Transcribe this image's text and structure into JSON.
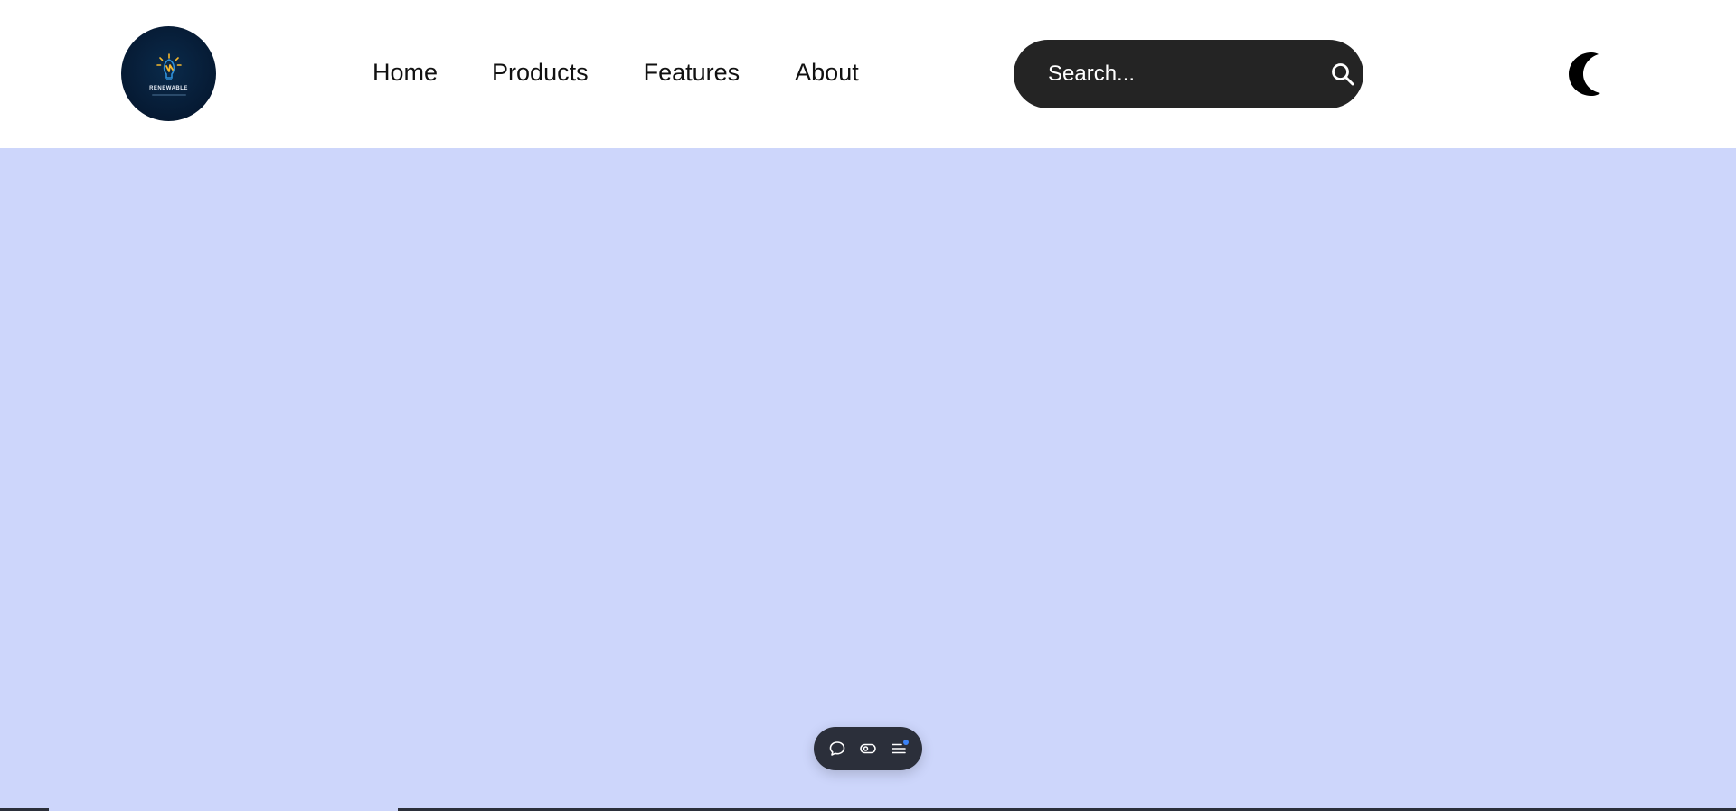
{
  "header": {
    "logo": {
      "icon": "lightbulb-leaf-icon",
      "text": "RENEWABLE"
    },
    "nav": [
      {
        "label": "Home"
      },
      {
        "label": "Products"
      },
      {
        "label": "Features"
      },
      {
        "label": "About"
      }
    ],
    "search": {
      "placeholder": "Search...",
      "value": "",
      "icon": "search-icon"
    },
    "theme_toggle": {
      "icon": "moon-icon"
    }
  },
  "floating_toolbar": {
    "items": [
      {
        "icon": "chat-bubble-icon"
      },
      {
        "icon": "toggle-icon"
      },
      {
        "icon": "menu-list-icon",
        "has_notification": true
      }
    ]
  },
  "colors": {
    "background": "#cdd6fb",
    "header_bg": "#ffffff",
    "search_bg": "#242424",
    "logo_bg": "#061a33",
    "logo_accent": "#f5b82e",
    "toolbar_bg": "#2b2f3a",
    "notification": "#3b82f6"
  }
}
